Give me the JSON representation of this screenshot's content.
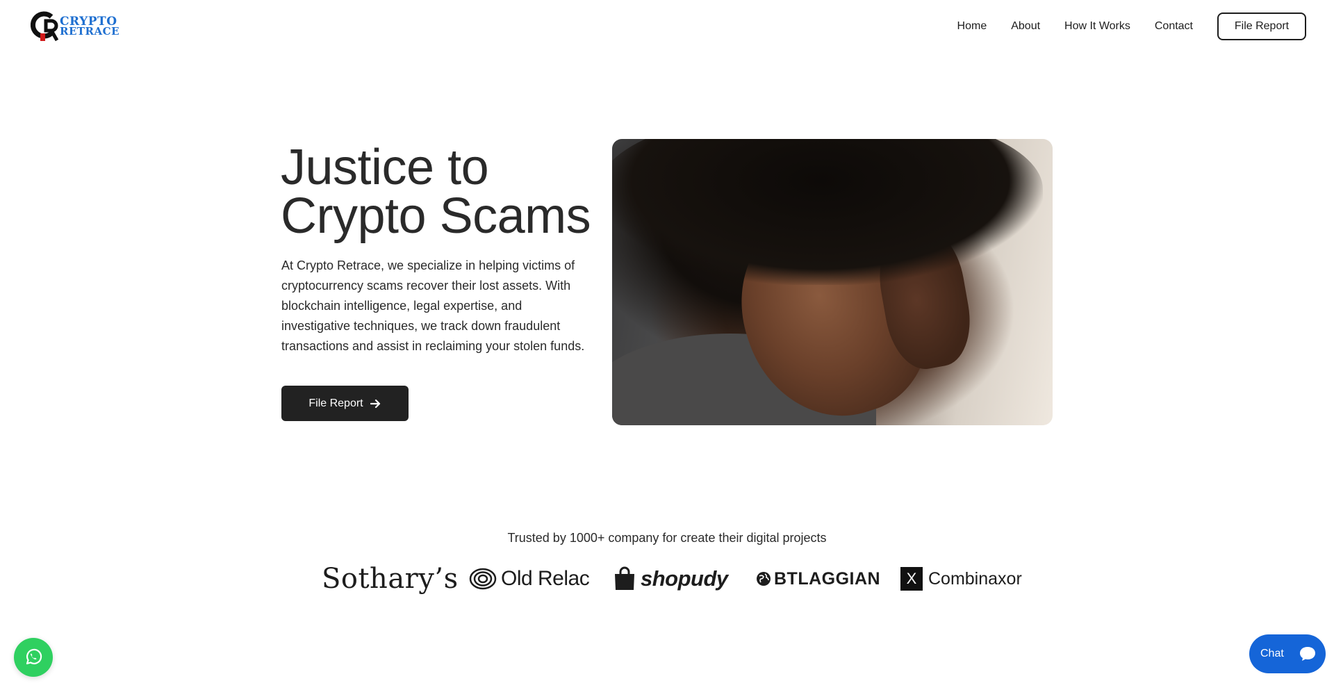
{
  "header": {
    "logo": {
      "line1": "CRYPTO",
      "line2": "RETRACE",
      "accent": "#1e6fd0",
      "mark_color": "#d11a1a"
    },
    "nav": [
      {
        "label": "Home"
      },
      {
        "label": "About"
      },
      {
        "label": "How It Works"
      },
      {
        "label": "Contact"
      }
    ],
    "cta_label": "File Report"
  },
  "hero": {
    "title_line1": "Justice to",
    "title_line2": "Crypto Scams",
    "description": "At Crypto Retrace, we specialize in helping victims of cryptocurrency scams recover their lost assets. With blockchain intelligence, legal expertise, and investigative techniques, we track down fraudulent transactions and assist in reclaiming your stolen funds.",
    "button_label": "File Report",
    "button_icon": "arrow-right-icon"
  },
  "trusted": {
    "heading": "Trusted by 1000+ company for create their digital projects",
    "brands": [
      {
        "name": "Sothary’s"
      },
      {
        "name": "Old Relac",
        "icon": "concentric-rings-icon"
      },
      {
        "name": "shopudy",
        "icon": "shopping-bag-icon"
      },
      {
        "name": "BTLAGGIAN",
        "icon": "globe-icon"
      },
      {
        "name": "Combinaxor",
        "icon": "x-box-icon",
        "icon_text": "X"
      }
    ]
  },
  "floating": {
    "whatsapp_icon": "whatsapp-icon",
    "whatsapp_color": "#2fd060",
    "chat_label": "Chat",
    "chat_color": "#1565d8"
  }
}
